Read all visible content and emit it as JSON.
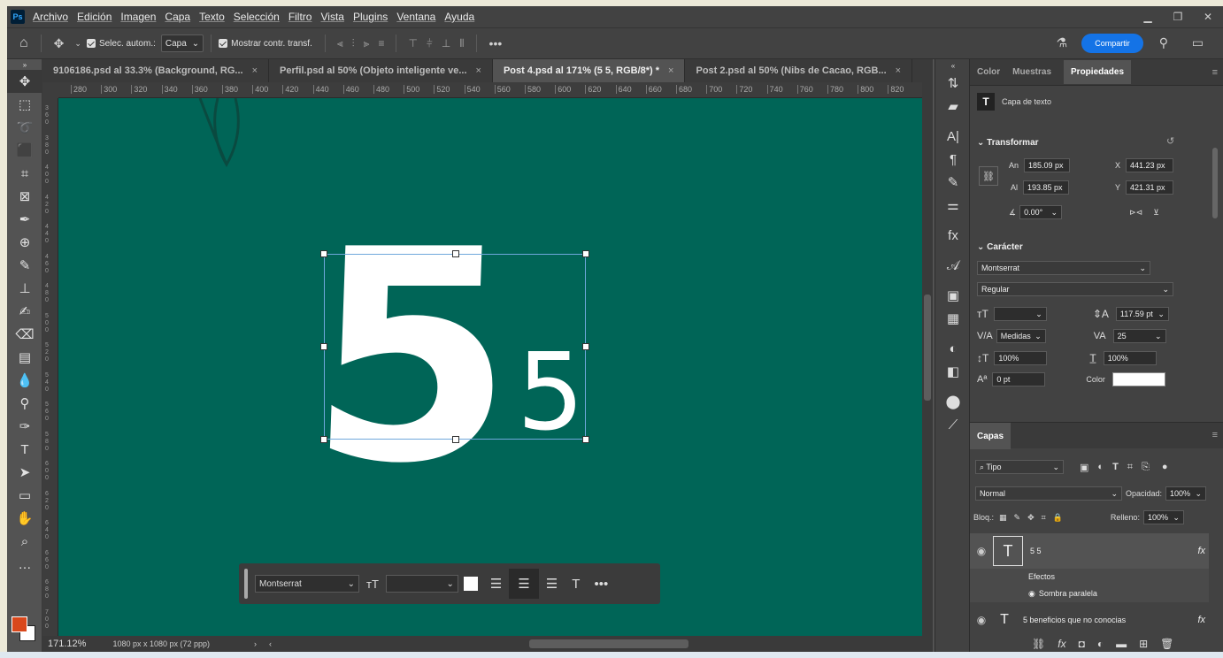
{
  "app": {
    "logo": "Ps"
  },
  "menu": [
    "Archivo",
    "Edición",
    "Imagen",
    "Capa",
    "Texto",
    "Selección",
    "Filtro",
    "Vista",
    "Plugins",
    "Ventana",
    "Ayuda"
  ],
  "options": {
    "auto_select_label": "Selec. autom.:",
    "auto_select_value": "Capa",
    "show_transform_label": "Mostrar contr. transf.",
    "more": "•••",
    "share_label": "Compartir"
  },
  "tabs": [
    {
      "label": "9106186.psd al 33.3% (Background, RG...",
      "active": false
    },
    {
      "label": "Perfil.psd al 50% (Objeto inteligente ve...",
      "active": false
    },
    {
      "label": "Post 4.psd al 171% (5 5, RGB/8*) *",
      "active": true
    },
    {
      "label": "Post 2.psd al 50% (Nibs de Cacao, RGB...",
      "active": false
    }
  ],
  "ruler_ticks": [
    "280",
    "300",
    "320",
    "340",
    "360",
    "380",
    "400",
    "420",
    "440",
    "460",
    "480",
    "500",
    "520",
    "540",
    "560",
    "580",
    "600",
    "620",
    "640",
    "660",
    "680",
    "700",
    "720",
    "740",
    "760",
    "780",
    "800",
    "820"
  ],
  "vruler_ticks": [
    "360",
    "380",
    "400",
    "420",
    "440",
    "460",
    "480",
    "500",
    "520",
    "540",
    "560",
    "580",
    "600",
    "620",
    "640",
    "660",
    "680",
    "700"
  ],
  "canvas": {
    "big_text": "5",
    "small_text": "5",
    "bg_color": "#006557"
  },
  "context_bar": {
    "font": "Montserrat",
    "more": "•••"
  },
  "status": {
    "zoom": "171.12%",
    "doc_size": "1080 px x 1080 px (72 ppp)"
  },
  "panel": {
    "tabs": [
      "Color",
      "Muestras",
      "Propiedades"
    ],
    "layer_kind": "Capa de texto",
    "transform_title": "Transformar",
    "an_label": "An",
    "an_value": "185.09 px",
    "al_label": "Al",
    "al_value": "193.85 px",
    "x_label": "X",
    "x_value": "441.23 px",
    "y_label": "Y",
    "y_value": "421.31 px",
    "angle_value": "0.00°",
    "character_title": "Carácter",
    "font_family": "Montserrat",
    "font_style": "Regular",
    "leading": "117.59 pt",
    "kerning": "Medidas",
    "tracking": "25",
    "vscale": "100%",
    "hscale": "100%",
    "baseline": "0 pt",
    "color_label": "Color"
  },
  "layers": {
    "title": "Capas",
    "filter": "Tipo",
    "blend": "Normal",
    "opacity_label": "Opacidad:",
    "opacity_value": "100%",
    "lock_label": "Bloq.:",
    "fill_label": "Relleno:",
    "fill_value": "100%",
    "items": [
      {
        "name": "5 5",
        "fx": "fx"
      },
      {
        "name": "5 beneficios que no conocias",
        "fx": "fx"
      }
    ],
    "effects_label": "Efectos",
    "shadow_label": "Sombra paralela"
  }
}
